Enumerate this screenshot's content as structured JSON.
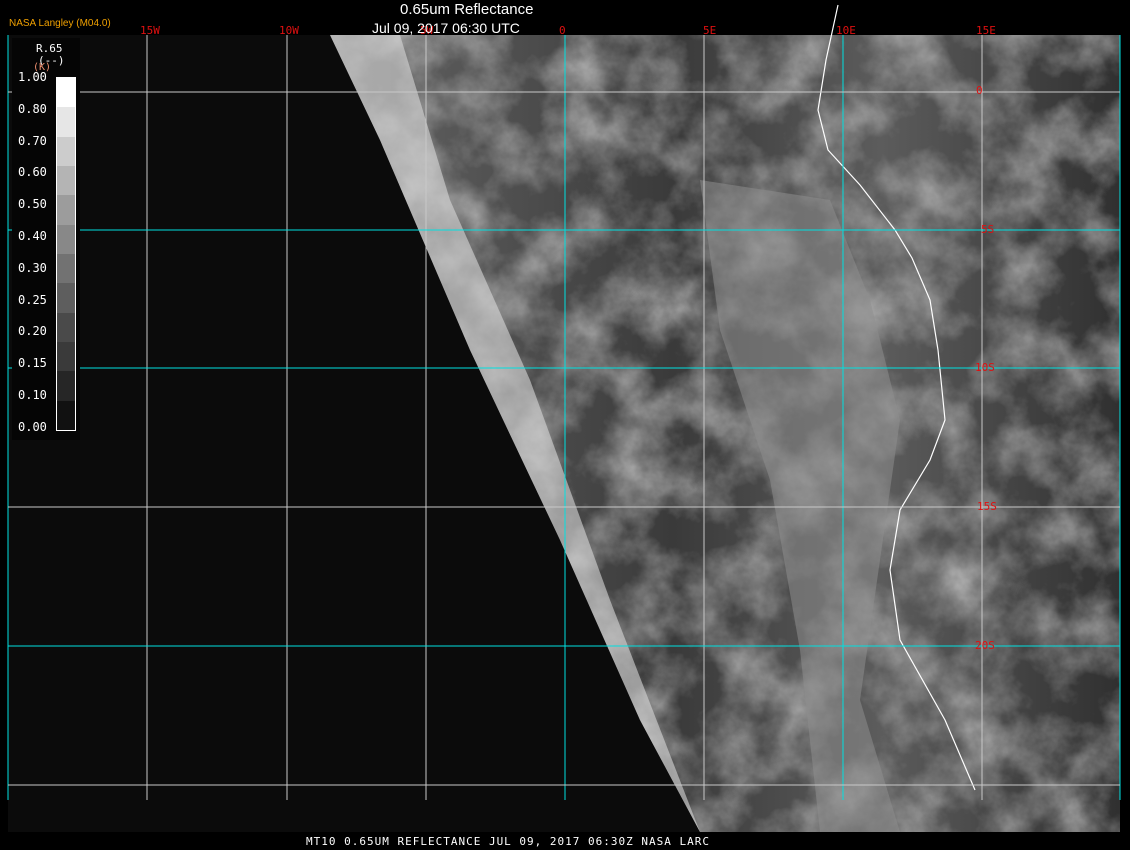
{
  "header": {
    "title": "0.65um Reflectance",
    "datetime": "Jul 09, 2017 06:30 UTC",
    "credit": "NASA Langley (M04.0)"
  },
  "longitude_labels": [
    "15W",
    "10W",
    "5W",
    "0",
    "5E",
    "10E",
    "15E"
  ],
  "latitude_labels": [
    "0",
    "5S",
    "10S",
    "15S",
    "20S"
  ],
  "colorbar": {
    "variable": "R.65",
    "units": "(--)",
    "extra": "(K)",
    "ticks": [
      "1.00",
      "0.80",
      "0.70",
      "0.60",
      "0.50",
      "0.40",
      "0.30",
      "0.25",
      "0.20",
      "0.15",
      "0.10",
      "0.00"
    ],
    "colors": [
      "#ffffff",
      "#e6e6e6",
      "#cccccc",
      "#b4b4b4",
      "#9c9c9c",
      "#888888",
      "#727272",
      "#5e5e5e",
      "#4a4a4a",
      "#3a3a3a",
      "#262626",
      "#111111"
    ]
  },
  "footer": "MT10  0.65UM REFLECTANCE   JUL 09, 2017 06:30Z   NASA LARC",
  "grid_colors": {
    "major": "#00e0e0",
    "minor": "#c8c8c8"
  },
  "label_color": "#e01010"
}
